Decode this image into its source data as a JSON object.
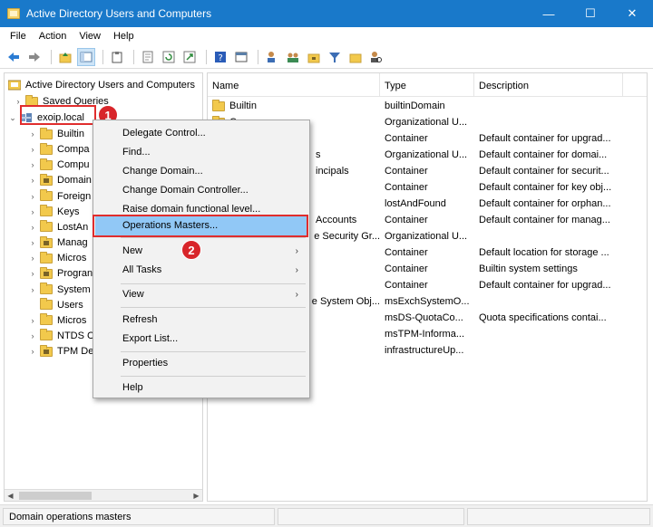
{
  "window": {
    "title": "Active Directory Users and Computers",
    "minimize": "—",
    "maximize": "☐",
    "close": "✕"
  },
  "menubar": [
    "File",
    "Action",
    "View",
    "Help"
  ],
  "tree": {
    "root": "Active Directory Users and Computers",
    "saved_queries": "Saved Queries",
    "domain": "exoip.local",
    "children": [
      "Builtin",
      "Compa",
      "Compu",
      "Domain",
      "Foreign",
      "Keys",
      "LostAn",
      "Manag",
      "Micros",
      "Progran",
      "System",
      "Users",
      "Micros",
      "NTDS C",
      "TPM De"
    ]
  },
  "list": {
    "headers": {
      "name": "Name",
      "type": "Type",
      "description": "Description"
    },
    "rows": [
      {
        "name": "Builtin",
        "type": "builtinDomain",
        "desc": ""
      },
      {
        "name": "C",
        "type": "Organizational U...",
        "desc": ""
      },
      {
        "name": "",
        "type": "Container",
        "desc": "Default container for upgrad..."
      },
      {
        "name": "s",
        "type": "Organizational U...",
        "desc": "Default container for domai..."
      },
      {
        "name": "incipals",
        "type": "Container",
        "desc": "Default container for securit..."
      },
      {
        "name": "",
        "type": "Container",
        "desc": "Default container for key obj..."
      },
      {
        "name": "",
        "type": "lostAndFound",
        "desc": "Default container for orphan..."
      },
      {
        "name": "Accounts",
        "type": "Container",
        "desc": "Default container for manag..."
      },
      {
        "name": "e Security Gr...",
        "type": "Organizational U...",
        "desc": ""
      },
      {
        "name": "",
        "type": "Container",
        "desc": "Default location for storage ..."
      },
      {
        "name": "",
        "type": "Container",
        "desc": "Builtin system settings"
      },
      {
        "name": "",
        "type": "Container",
        "desc": "Default container for upgrad..."
      },
      {
        "name": "e System Obj...",
        "type": "msExchSystemO...",
        "desc": ""
      },
      {
        "name": "",
        "type": "msDS-QuotaCo...",
        "desc": "Quota specifications contai..."
      },
      {
        "name": "",
        "type": "msTPM-Informa...",
        "desc": ""
      },
      {
        "name": "",
        "type": "infrastructureUp...",
        "desc": ""
      }
    ]
  },
  "context_menu": {
    "delegate": "Delegate Control...",
    "find": "Find...",
    "change_domain": "Change Domain...",
    "change_dc": "Change Domain Controller...",
    "raise_level": "Raise domain functional level...",
    "operations_masters": "Operations Masters...",
    "new": "New",
    "all_tasks": "All Tasks",
    "view": "View",
    "refresh": "Refresh",
    "export": "Export List...",
    "properties": "Properties",
    "help": "Help"
  },
  "callouts": {
    "one": "1",
    "two": "2"
  },
  "status": {
    "text": "Domain operations masters"
  },
  "colors": {
    "titlebar": "#1979ca",
    "highlight": "#91c8f6",
    "callout": "#d8252a"
  }
}
